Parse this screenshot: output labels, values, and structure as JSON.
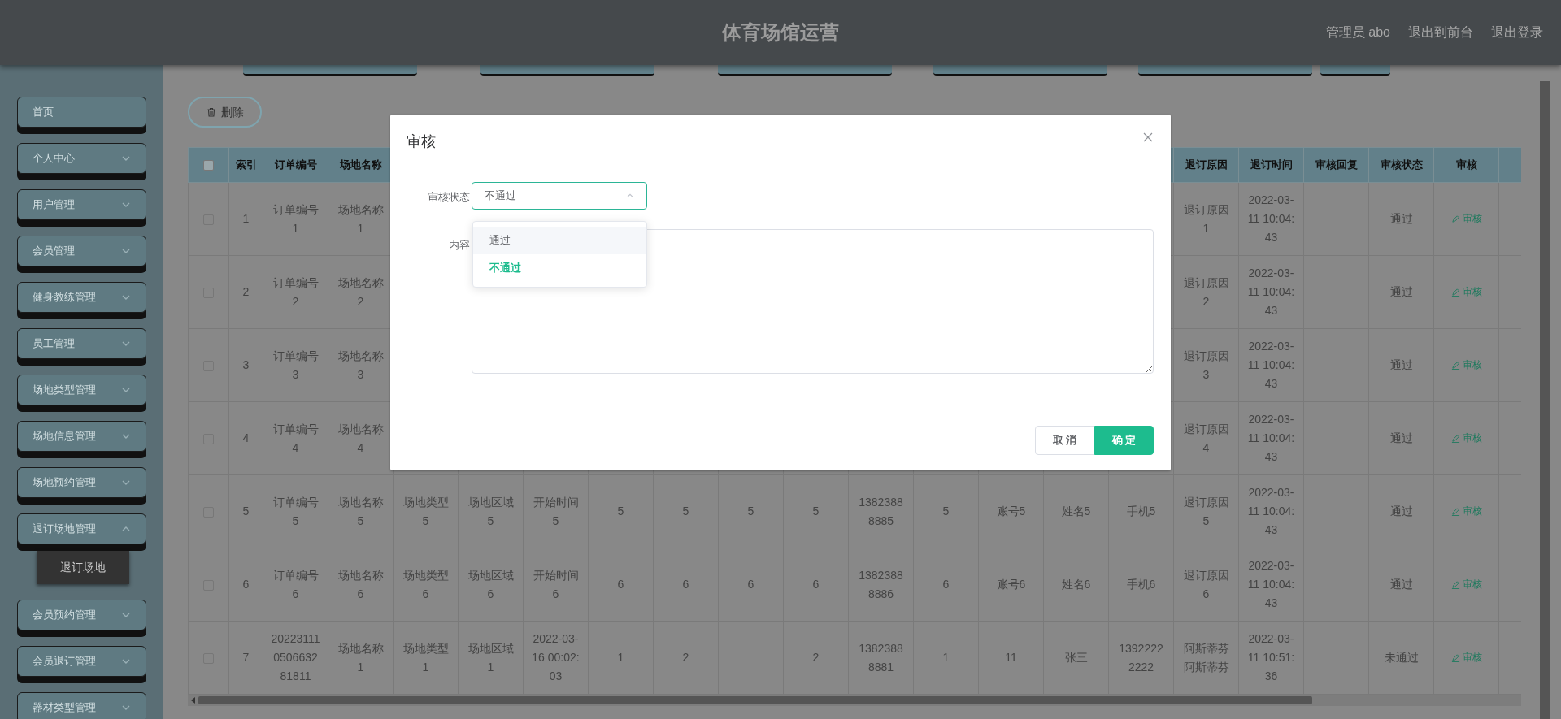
{
  "header": {
    "title": "体育场馆运营",
    "user": "管理员 abo",
    "links": [
      "退出到前台",
      "退出登录"
    ]
  },
  "sidebar": {
    "items": [
      {
        "label": "首页",
        "kind": "link"
      },
      {
        "label": "个人中心",
        "kind": "menu",
        "expanded": false
      },
      {
        "label": "用户管理",
        "kind": "menu",
        "expanded": false
      },
      {
        "label": "会员管理",
        "kind": "menu",
        "expanded": false
      },
      {
        "label": "健身教练管理",
        "kind": "menu",
        "expanded": false
      },
      {
        "label": "员工管理",
        "kind": "menu",
        "expanded": false
      },
      {
        "label": "场地类型管理",
        "kind": "menu",
        "expanded": false
      },
      {
        "label": "场地信息管理",
        "kind": "menu",
        "expanded": false
      },
      {
        "label": "场地预约管理",
        "kind": "menu",
        "expanded": false
      },
      {
        "label": "退订场地管理",
        "kind": "menu",
        "expanded": true,
        "children": [
          {
            "label": "退订场地",
            "selected": true
          }
        ]
      },
      {
        "label": "会员预约管理",
        "kind": "menu",
        "expanded": false
      },
      {
        "label": "会员退订管理",
        "kind": "menu",
        "expanded": false
      },
      {
        "label": "器材类型管理",
        "kind": "menu",
        "expanded": false
      }
    ]
  },
  "toolbar": {
    "delete_button": "删除"
  },
  "table": {
    "select_all": {
      "checked": false
    },
    "columns": [
      "索引",
      "订单编号",
      "场地名称",
      null,
      null,
      null,
      null,
      null,
      null,
      null,
      null,
      null,
      null,
      null,
      null,
      "退订原因",
      "退订时间",
      "审核回复",
      "审核状态",
      "审核"
    ],
    "rows": [
      {
        "checked": false,
        "cells": [
          "1",
          "订单编号1",
          "场地名称1",
          null,
          null,
          null,
          null,
          null,
          null,
          null,
          null,
          null,
          null,
          null,
          null,
          "退订原因1",
          "2022-03-11 10:04:43",
          null,
          "通过"
        ],
        "action": "审核"
      },
      {
        "checked": false,
        "cells": [
          "2",
          "订单编号2",
          "场地名称2",
          null,
          null,
          null,
          null,
          null,
          null,
          null,
          null,
          null,
          null,
          null,
          null,
          "退订原因2",
          "2022-03-11 10:04:43",
          null,
          "通过"
        ],
        "action": "审核"
      },
      {
        "checked": false,
        "cells": [
          "3",
          "订单编号3",
          "场地名称3",
          null,
          null,
          null,
          null,
          null,
          null,
          null,
          null,
          null,
          null,
          null,
          null,
          "退订原因3",
          "2022-03-11 10:04:43",
          null,
          "通过"
        ],
        "action": "审核"
      },
      {
        "checked": false,
        "cells": [
          "4",
          "订单编号4",
          "场地名称4",
          null,
          null,
          null,
          null,
          null,
          null,
          null,
          null,
          null,
          null,
          null,
          null,
          "退订原因4",
          "2022-03-11 10:04:43",
          null,
          "通过"
        ],
        "action": "审核"
      },
      {
        "checked": false,
        "cells": [
          "5",
          "订单编号5",
          "场地名称5",
          "场地类型5",
          "场地区域5",
          "开始时间5",
          "5",
          "5",
          "5",
          "5",
          "13823888885",
          "5",
          "账号5",
          "姓名5",
          "手机5",
          "退订原因5",
          "2022-03-11 10:04:43",
          null,
          "通过"
        ],
        "action": "审核"
      },
      {
        "checked": false,
        "cells": [
          "6",
          "订单编号6",
          "场地名称6",
          "场地类型6",
          "场地区域6",
          "开始时间6",
          "6",
          "6",
          "6",
          "6",
          "13823888886",
          "6",
          "账号6",
          "姓名6",
          "手机6",
          "退订原因6",
          "2022-03-11 10:04:43",
          null,
          "通过"
        ],
        "action": "审核"
      },
      {
        "checked": false,
        "cells": [
          "7",
          "20223111050663281811",
          "场地名称1",
          "场地类型1",
          "场地区域1",
          "2022-03-16 00:02:03",
          "1",
          "2",
          null,
          "2",
          "13823888881",
          "1",
          "11",
          "张三",
          "13922222222",
          "阿斯蒂芬阿斯蒂芬",
          "2022-03-11 10:51:36",
          null,
          "未通过"
        ],
        "action": "审核"
      }
    ]
  },
  "dialog": {
    "title": "审核",
    "fields": [
      {
        "kind": "select",
        "label": "审核状态",
        "value": "不通过",
        "expanded": true,
        "options": [
          {
            "label": "通过",
            "hovered": true,
            "selected": false
          },
          {
            "label": "不通过",
            "hovered": false,
            "selected": true
          }
        ]
      },
      {
        "kind": "textarea",
        "label": "内容"
      }
    ],
    "buttons": [
      {
        "label": "取 消",
        "kind": "default"
      },
      {
        "label": "确 定",
        "kind": "primary"
      }
    ]
  }
}
